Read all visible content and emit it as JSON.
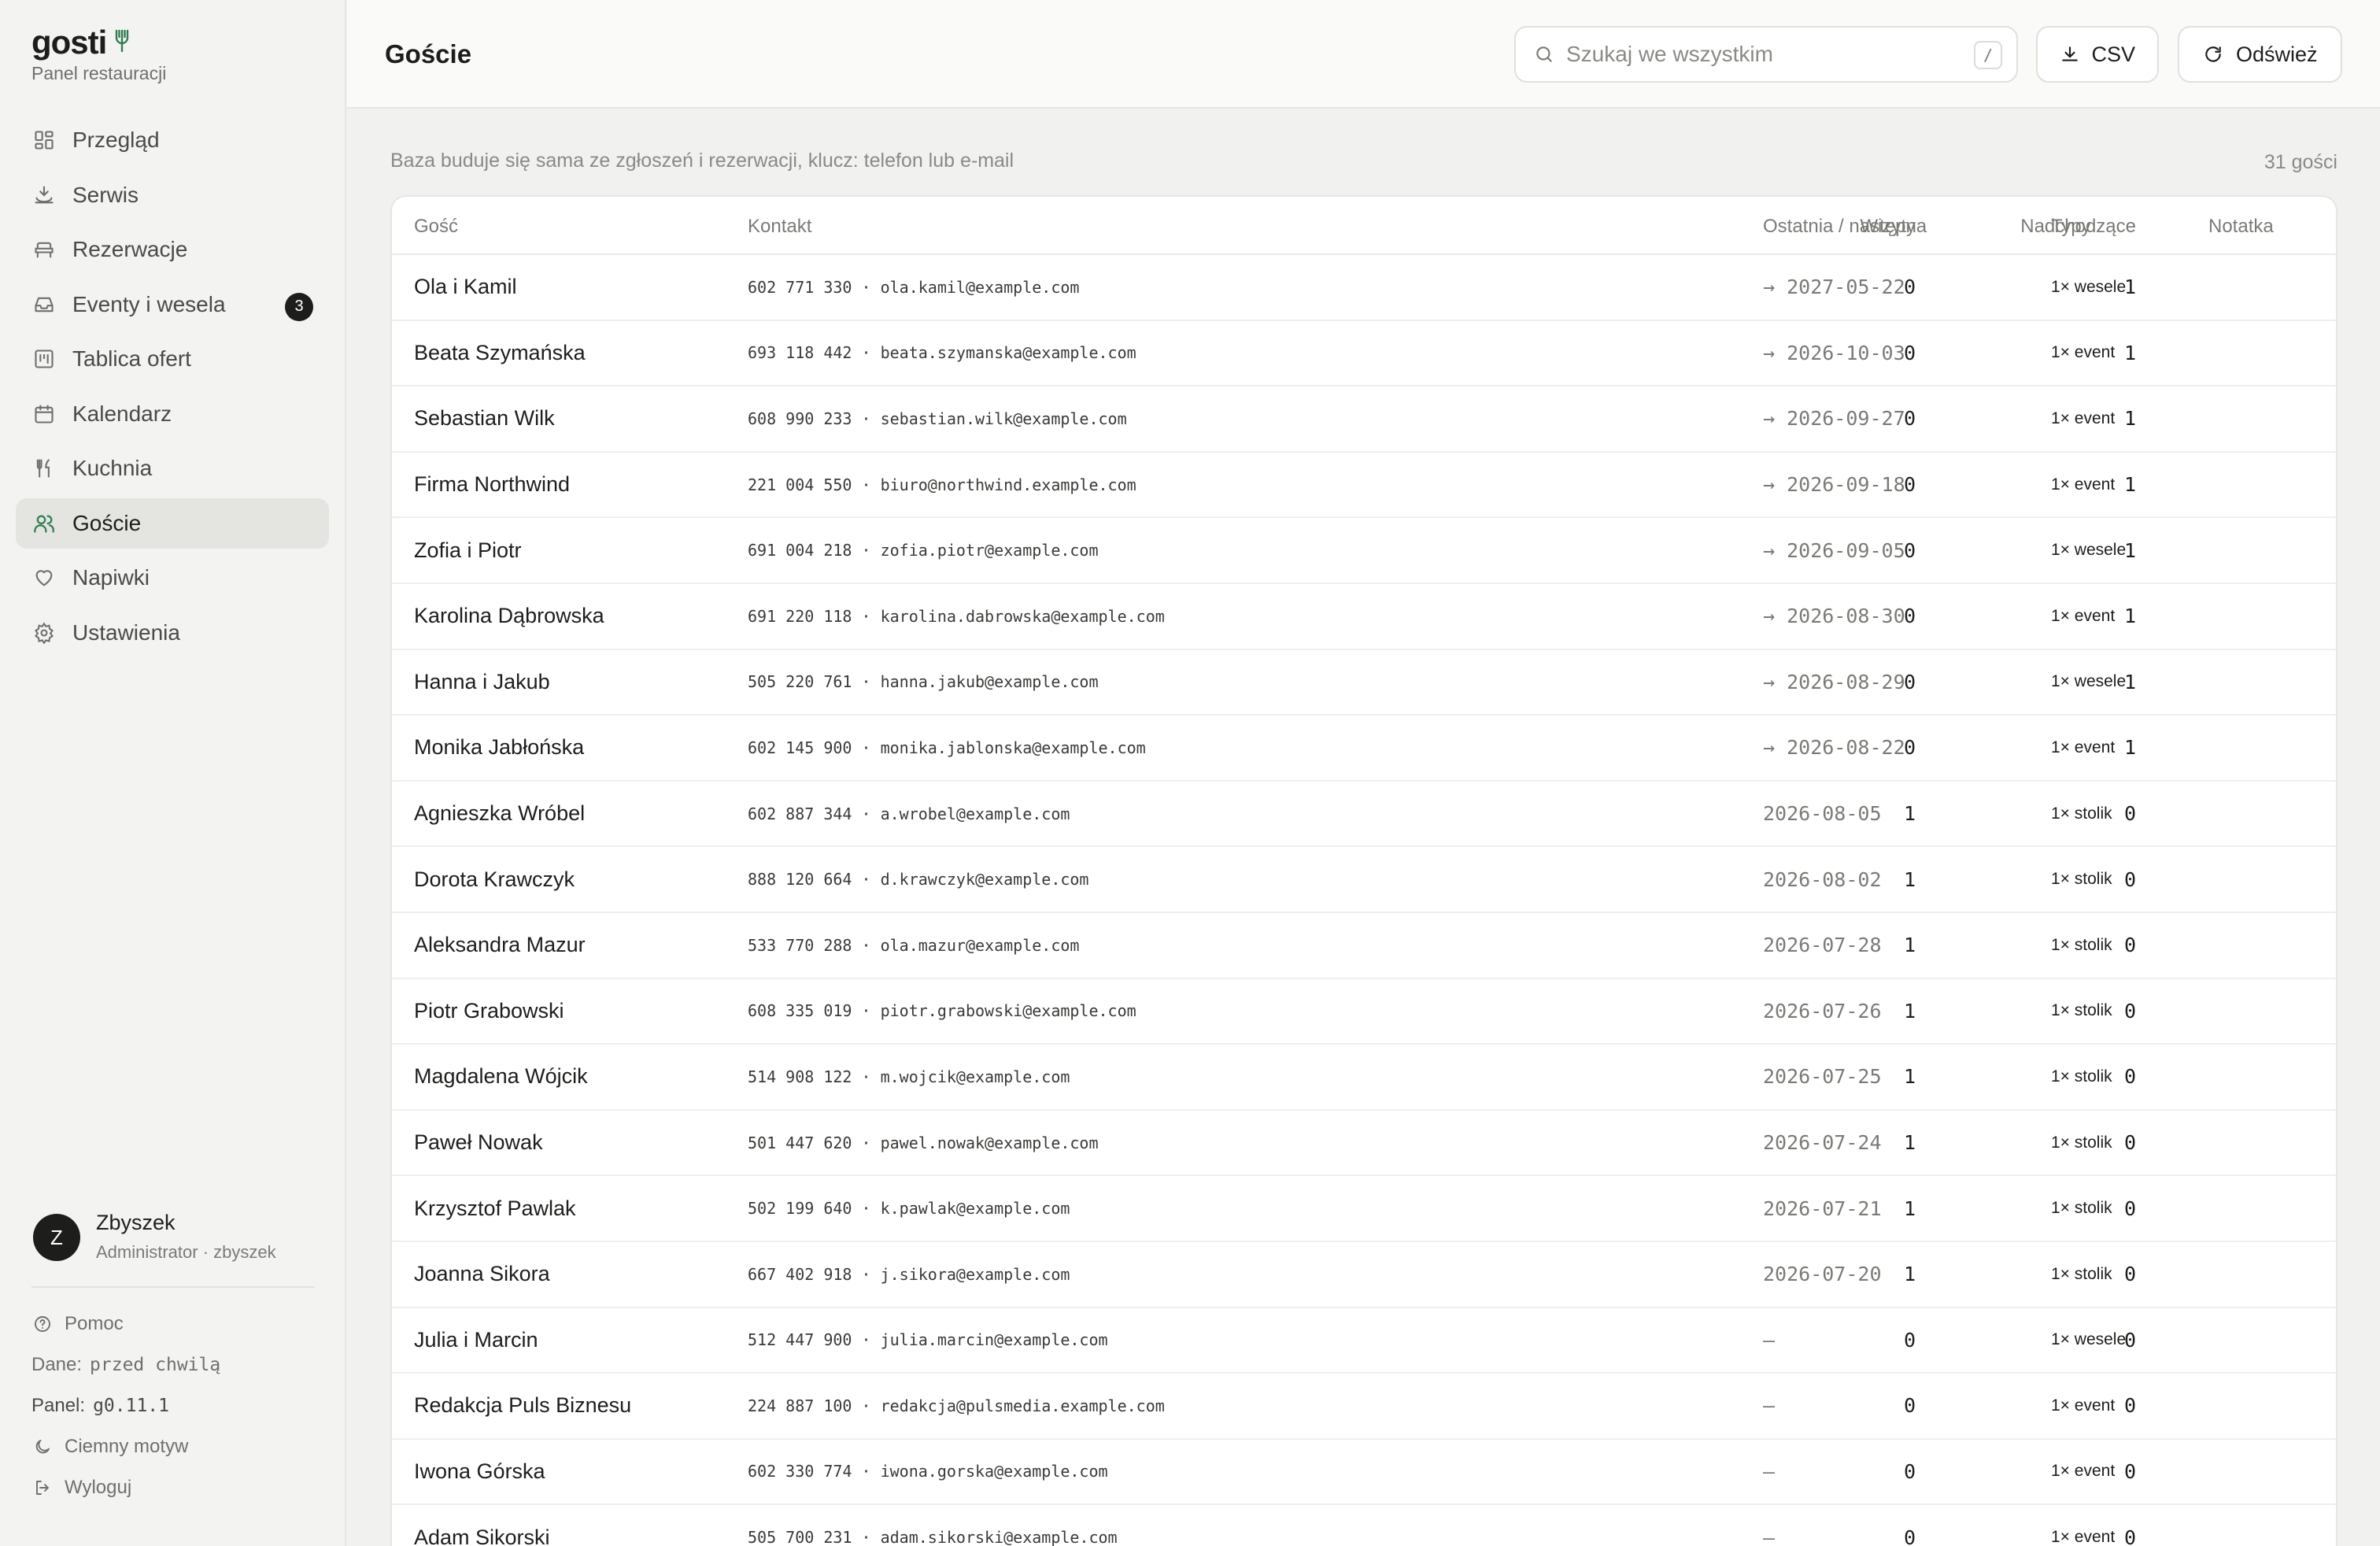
{
  "brand": {
    "name": "gosti",
    "subtitle": "Panel restauracji"
  },
  "nav": [
    {
      "label": "Przegląd",
      "icon": "grid-icon",
      "active": false
    },
    {
      "label": "Serwis",
      "icon": "service-bell-icon",
      "active": false
    },
    {
      "label": "Rezerwacje",
      "icon": "chair-icon",
      "active": false
    },
    {
      "label": "Eventy i wesela",
      "icon": "inbox-icon",
      "active": false,
      "badge": "3"
    },
    {
      "label": "Tablica ofert",
      "icon": "board-icon",
      "active": false
    },
    {
      "label": "Kalendarz",
      "icon": "calendar-icon",
      "active": false
    },
    {
      "label": "Kuchnia",
      "icon": "utensils-icon",
      "active": false
    },
    {
      "label": "Goście",
      "icon": "users-icon",
      "active": true
    },
    {
      "label": "Napiwki",
      "icon": "heart-icon",
      "active": false
    },
    {
      "label": "Ustawienia",
      "icon": "gear-icon",
      "active": false
    }
  ],
  "user": {
    "initial": "Z",
    "name": "Zbyszek",
    "role": "Administrator · zbyszek"
  },
  "footer": {
    "help": "Pomoc",
    "data_label": "Dane:",
    "data_value": "przed chwilą",
    "panel_label": "Panel:",
    "panel_value": "g0.11.1",
    "dark_mode": "Ciemny motyw",
    "logout": "Wyloguj"
  },
  "header": {
    "title": "Goście",
    "search_placeholder": "Szukaj we wszystkim",
    "search_shortcut": "/",
    "csv_label": "CSV",
    "refresh_label": "Odśwież"
  },
  "main": {
    "subtitle": "Baza buduje się sama ze zgłoszeń i rezerwacji, klucz: telefon lub e-mail",
    "count": "31 gości"
  },
  "table": {
    "columns": {
      "guest": "Gość",
      "contact": "Kontakt",
      "visits": "Wizyty",
      "upcoming": "Nadchodzące",
      "last_next": "Ostatnia / następna",
      "types": "Typy",
      "note": "Notatka"
    },
    "rows": [
      {
        "name": "Ola i Kamil",
        "contact": "602 771 330 · ola.kamil@example.com",
        "visits": "0",
        "upcoming": "1",
        "last_next": "→ 2027-05-22",
        "types": "1× wesele",
        "note": ""
      },
      {
        "name": "Beata Szymańska",
        "contact": "693 118 442 · beata.szymanska@example.com",
        "visits": "0",
        "upcoming": "1",
        "last_next": "→ 2026-10-03",
        "types": "1× event",
        "note": ""
      },
      {
        "name": "Sebastian Wilk",
        "contact": "608 990 233 · sebastian.wilk@example.com",
        "visits": "0",
        "upcoming": "1",
        "last_next": "→ 2026-09-27",
        "types": "1× event",
        "note": ""
      },
      {
        "name": "Firma Northwind",
        "contact": "221 004 550 · biuro@northwind.example.com",
        "visits": "0",
        "upcoming": "1",
        "last_next": "→ 2026-09-18",
        "types": "1× event",
        "note": ""
      },
      {
        "name": "Zofia i Piotr",
        "contact": "691 004 218 · zofia.piotr@example.com",
        "visits": "0",
        "upcoming": "1",
        "last_next": "→ 2026-09-05",
        "types": "1× wesele",
        "note": ""
      },
      {
        "name": "Karolina Dąbrowska",
        "contact": "691 220 118 · karolina.dabrowska@example.com",
        "visits": "0",
        "upcoming": "1",
        "last_next": "→ 2026-08-30",
        "types": "1× event",
        "note": ""
      },
      {
        "name": "Hanna i Jakub",
        "contact": "505 220 761 · hanna.jakub@example.com",
        "visits": "0",
        "upcoming": "1",
        "last_next": "→ 2026-08-29",
        "types": "1× wesele",
        "note": ""
      },
      {
        "name": "Monika Jabłońska",
        "contact": "602 145 900 · monika.jablonska@example.com",
        "visits": "0",
        "upcoming": "1",
        "last_next": "→ 2026-08-22",
        "types": "1× event",
        "note": ""
      },
      {
        "name": "Agnieszka Wróbel",
        "contact": "602 887 344 · a.wrobel@example.com",
        "visits": "1",
        "upcoming": "0",
        "last_next": "2026-08-05",
        "types": "1× stolik",
        "note": ""
      },
      {
        "name": "Dorota Krawczyk",
        "contact": "888 120 664 · d.krawczyk@example.com",
        "visits": "1",
        "upcoming": "0",
        "last_next": "2026-08-02",
        "types": "1× stolik",
        "note": ""
      },
      {
        "name": "Aleksandra Mazur",
        "contact": "533 770 288 · ola.mazur@example.com",
        "visits": "1",
        "upcoming": "0",
        "last_next": "2026-07-28",
        "types": "1× stolik",
        "note": ""
      },
      {
        "name": "Piotr Grabowski",
        "contact": "608 335 019 · piotr.grabowski@example.com",
        "visits": "1",
        "upcoming": "0",
        "last_next": "2026-07-26",
        "types": "1× stolik",
        "note": ""
      },
      {
        "name": "Magdalena Wójcik",
        "contact": "514 908 122 · m.wojcik@example.com",
        "visits": "1",
        "upcoming": "0",
        "last_next": "2026-07-25",
        "types": "1× stolik",
        "note": ""
      },
      {
        "name": "Paweł Nowak",
        "contact": "501 447 620 · pawel.nowak@example.com",
        "visits": "1",
        "upcoming": "0",
        "last_next": "2026-07-24",
        "types": "1× stolik",
        "note": ""
      },
      {
        "name": "Krzysztof Pawlak",
        "contact": "502 199 640 · k.pawlak@example.com",
        "visits": "1",
        "upcoming": "0",
        "last_next": "2026-07-21",
        "types": "1× stolik",
        "note": ""
      },
      {
        "name": "Joanna Sikora",
        "contact": "667 402 918 · j.sikora@example.com",
        "visits": "1",
        "upcoming": "0",
        "last_next": "2026-07-20",
        "types": "1× stolik",
        "note": ""
      },
      {
        "name": "Julia i Marcin",
        "contact": "512 447 900 · julia.marcin@example.com",
        "visits": "0",
        "upcoming": "0",
        "last_next": "–",
        "types": "1× wesele",
        "note": ""
      },
      {
        "name": "Redakcja Puls Biznesu",
        "contact": "224 887 100 · redakcja@pulsmedia.example.com",
        "visits": "0",
        "upcoming": "0",
        "last_next": "–",
        "types": "1× event",
        "note": ""
      },
      {
        "name": "Iwona Górska",
        "contact": "602 330 774 · iwona.gorska@example.com",
        "visits": "0",
        "upcoming": "0",
        "last_next": "–",
        "types": "1× event",
        "note": ""
      },
      {
        "name": "Adam Sikorski",
        "contact": "505 700 231 · adam.sikorski@example.com",
        "visits": "0",
        "upcoming": "0",
        "last_next": "–",
        "types": "1× event",
        "note": ""
      }
    ]
  },
  "colors": {
    "accent": "#2f7d4f",
    "text": "#1d1d1b",
    "muted": "#7a7a76",
    "active_nav": "#e4e4e1"
  }
}
